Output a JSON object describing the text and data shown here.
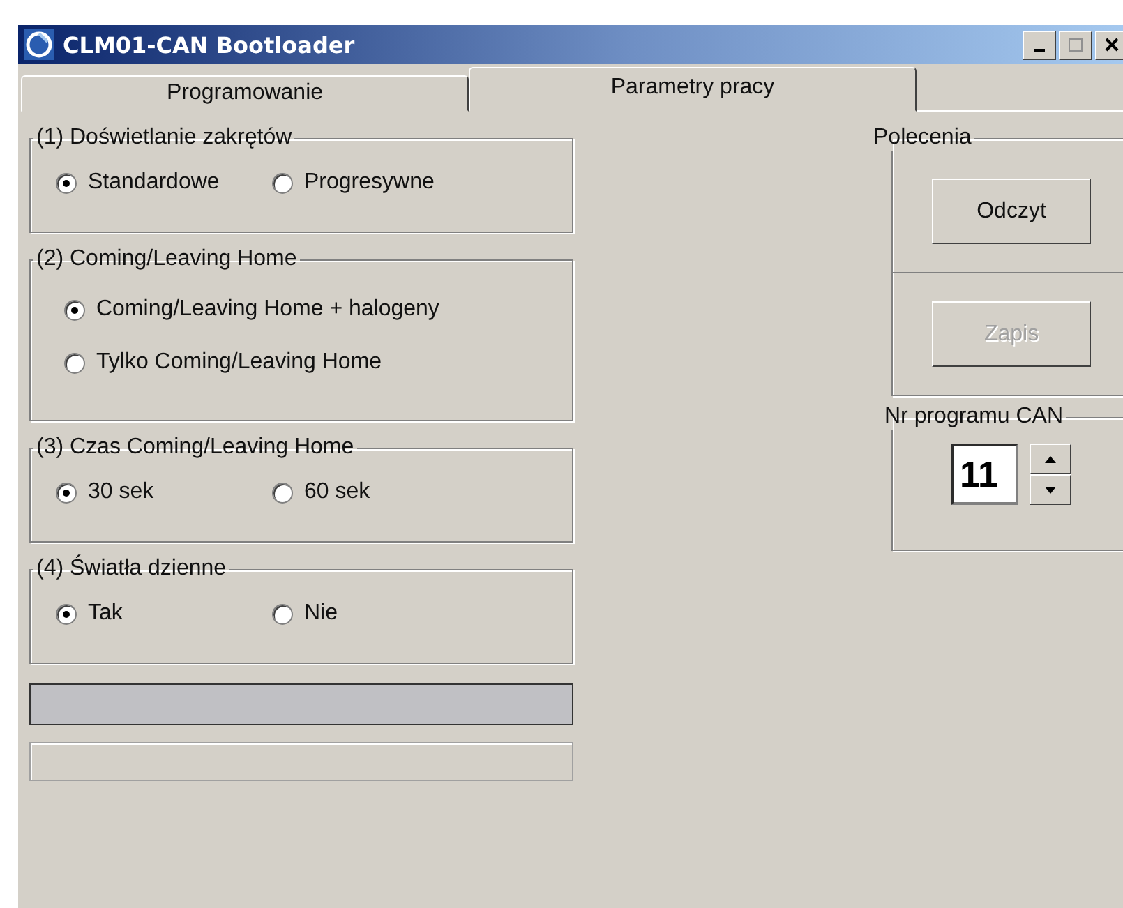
{
  "window": {
    "title": "CLM01-CAN Bootloader"
  },
  "tabs": [
    {
      "label": "Programowanie",
      "selected": false
    },
    {
      "label": "Parametry pracy",
      "selected": true
    }
  ],
  "groups": [
    {
      "title": "(1) Doświetlanie zakrętów",
      "kind": "row",
      "options": [
        {
          "label": "Standardowe",
          "selected": true
        },
        {
          "label": "Progresywne",
          "selected": false
        }
      ]
    },
    {
      "title": "(2) Coming/Leaving Home",
      "kind": "column",
      "options": [
        {
          "label": "Coming/Leaving Home + halogeny",
          "selected": true
        },
        {
          "label": "Tylko Coming/Leaving Home",
          "selected": false
        }
      ]
    },
    {
      "title": "(3) Czas Coming/Leaving Home",
      "kind": "row",
      "options": [
        {
          "label": "30 sek",
          "selected": true
        },
        {
          "label": "60 sek",
          "selected": false
        }
      ]
    },
    {
      "title": "(4) Światła dzienne",
      "kind": "row",
      "options": [
        {
          "label": "Tak",
          "selected": true
        },
        {
          "label": "Nie",
          "selected": false
        }
      ]
    }
  ],
  "commands": {
    "title": "Polecenia",
    "buttons": [
      {
        "label": "Odczyt",
        "disabled": false
      },
      {
        "label": "Zapis",
        "disabled": true
      }
    ]
  },
  "program": {
    "title": "Nr programu CAN",
    "value": "11"
  }
}
